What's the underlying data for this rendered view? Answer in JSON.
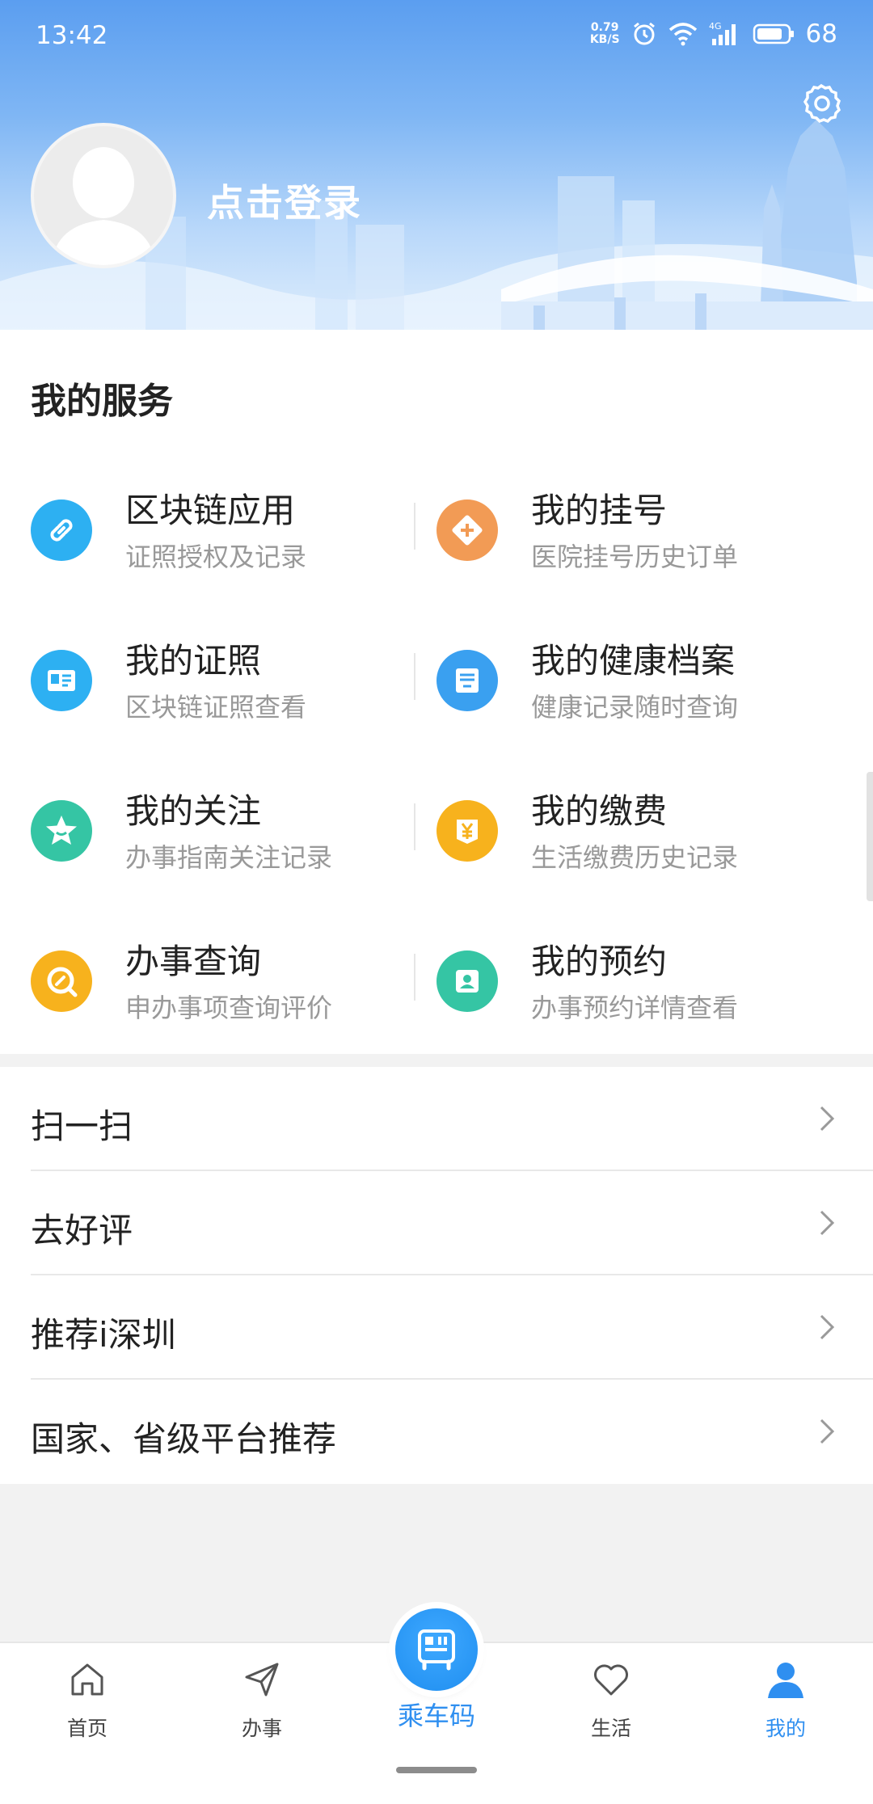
{
  "status_bar": {
    "time": "13:42",
    "net_speed_value": "0.79",
    "net_speed_unit": "KB/S",
    "network": "4G",
    "battery": "68"
  },
  "profile": {
    "login_label": "点击登录"
  },
  "services": {
    "title": "我的服务",
    "items": [
      {
        "title": "区块链应用",
        "subtitle": "证照授权及记录",
        "icon": "link-icon",
        "color": "#2db0f2"
      },
      {
        "title": "我的挂号",
        "subtitle": "医院挂号历史订单",
        "icon": "medical-plus-icon",
        "color": "#f29b55"
      },
      {
        "title": "我的证照",
        "subtitle": "区块链证照查看",
        "icon": "id-card-icon",
        "color": "#2db0f2"
      },
      {
        "title": "我的健康档案",
        "subtitle": "健康记录随时查询",
        "icon": "health-record-icon",
        "color": "#3aa0f0"
      },
      {
        "title": "我的关注",
        "subtitle": "办事指南关注记录",
        "icon": "star-icon",
        "color": "#35c5a4"
      },
      {
        "title": "我的缴费",
        "subtitle": "生活缴费历史记录",
        "icon": "yen-icon",
        "color": "#f7b21d"
      },
      {
        "title": "办事查询",
        "subtitle": "申办事项查询评价",
        "icon": "search-pen-icon",
        "color": "#f7b21d"
      },
      {
        "title": "我的预约",
        "subtitle": "办事预约详情查看",
        "icon": "contact-icon",
        "color": "#35c5a4"
      }
    ]
  },
  "menu": {
    "items": [
      {
        "label": "扫一扫"
      },
      {
        "label": "去好评"
      },
      {
        "label": "推荐i深圳"
      },
      {
        "label": "国家、省级平台推荐"
      }
    ]
  },
  "bottom_nav": {
    "home": "首页",
    "affairs": "办事",
    "ride_code": "乘车码",
    "life": "生活",
    "mine": "我的",
    "active_color": "#2f8ff0"
  }
}
